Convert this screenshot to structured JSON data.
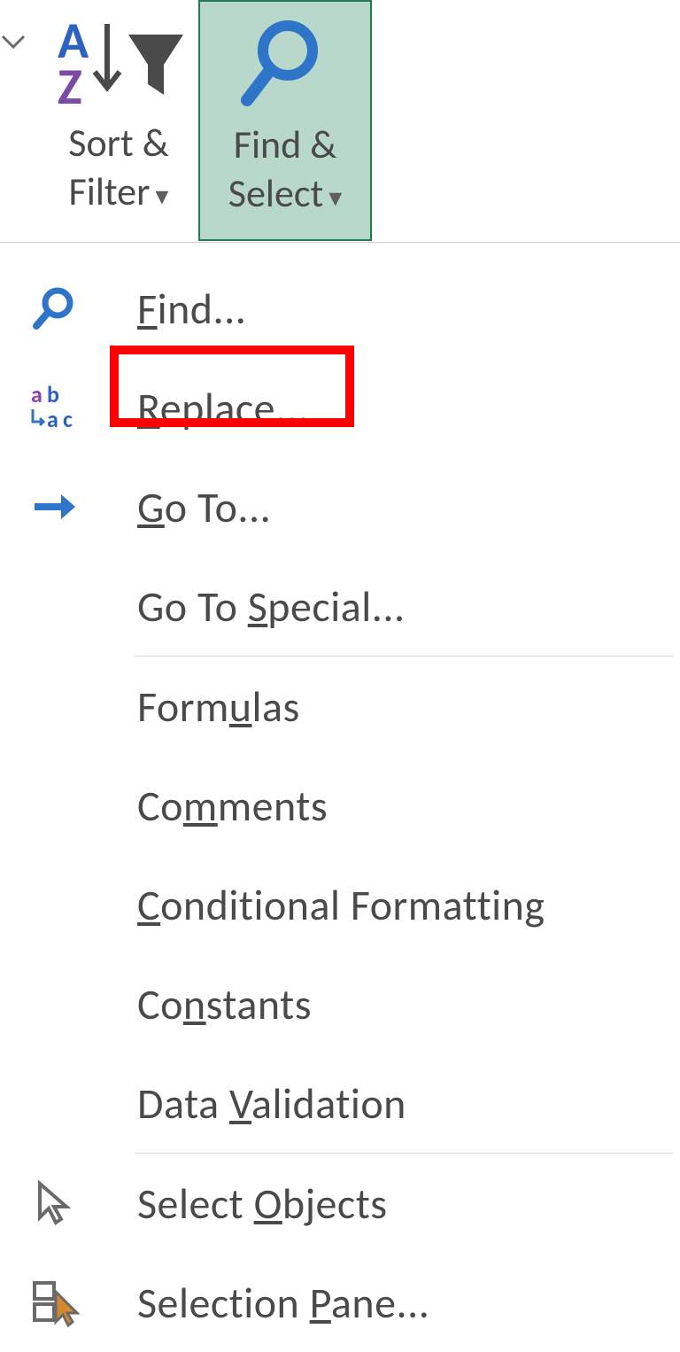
{
  "ribbon": {
    "sort_filter": {
      "line1": "Sort &",
      "line2": "Filter"
    },
    "find_select": {
      "line1": "Find &",
      "line2": "Select"
    }
  },
  "menu": {
    "find": "Find...",
    "replace": "Replace...",
    "goto": "Go To...",
    "gotospecial": "Go To Special...",
    "formulas": "Formulas",
    "comments": "Comments",
    "conditional": "Conditional Formatting",
    "constants": "Constants",
    "datavalidation": "Data Validation",
    "selectobjects": "Select Objects",
    "selectionpane": "Selection Pane..."
  }
}
